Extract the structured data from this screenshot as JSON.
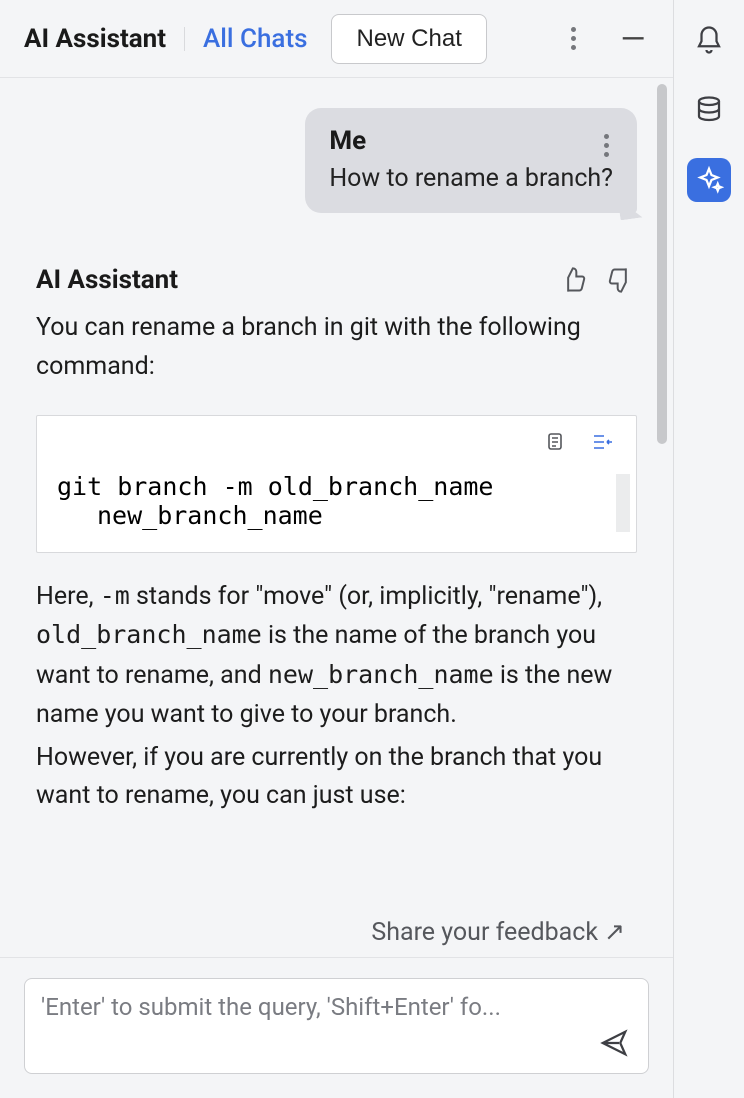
{
  "header": {
    "title": "AI Assistant",
    "all_chats": "All Chats",
    "new_chat": "New Chat"
  },
  "user_message": {
    "sender": "Me",
    "text": "How to rename a branch?"
  },
  "assistant_message": {
    "sender": "AI Assistant",
    "intro": "You can rename a branch in git with the following command:",
    "code_line1": "git branch -m old_branch_name",
    "code_line2": "new_branch_name",
    "explain_1a": "Here, ",
    "explain_1_code1": "-m",
    "explain_1b": " stands for \"move\" (or, implicitly, \"rename\"), ",
    "explain_1_code2": "old_branch_name",
    "explain_1c": " is the name of the branch you want to rename, and ",
    "explain_1_code3": "new_branch_name",
    "explain_1d": " is the new name you want to give to your branch.",
    "explain_2": "However, if you are currently on the branch that you want to rename, you can just use:"
  },
  "feedback_link": "Share your feedback",
  "feedback_arrow": "↗",
  "input": {
    "placeholder": "'Enter' to submit the query, 'Shift+Enter' fo..."
  }
}
